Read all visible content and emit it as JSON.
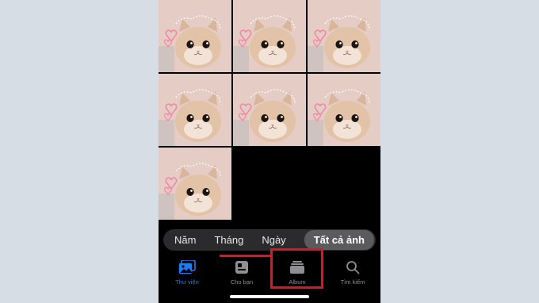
{
  "photos": [
    {
      "alt": "cat-photo"
    },
    {
      "alt": "cat-photo"
    },
    {
      "alt": "cat-photo"
    },
    {
      "alt": "cat-photo"
    },
    {
      "alt": "cat-photo"
    },
    {
      "alt": "cat-photo"
    },
    {
      "alt": "cat-photo"
    }
  ],
  "segments": [
    {
      "label": "Năm",
      "selected": false
    },
    {
      "label": "Tháng",
      "selected": false
    },
    {
      "label": "Ngày",
      "selected": false
    },
    {
      "label": "Tất cả ảnh",
      "selected": true
    }
  ],
  "tabs": [
    {
      "label": "Thư viện",
      "icon": "photos-library-icon",
      "active": true
    },
    {
      "label": "Cho bạn",
      "icon": "for-you-icon",
      "active": false
    },
    {
      "label": "Album",
      "icon": "album-icon",
      "active": false
    },
    {
      "label": "Tìm kiếm",
      "icon": "search-icon",
      "active": false
    }
  ],
  "colors": {
    "accent": "#1e7cf2",
    "annotation_red": "#e3141b",
    "background": "#d7dde5"
  }
}
